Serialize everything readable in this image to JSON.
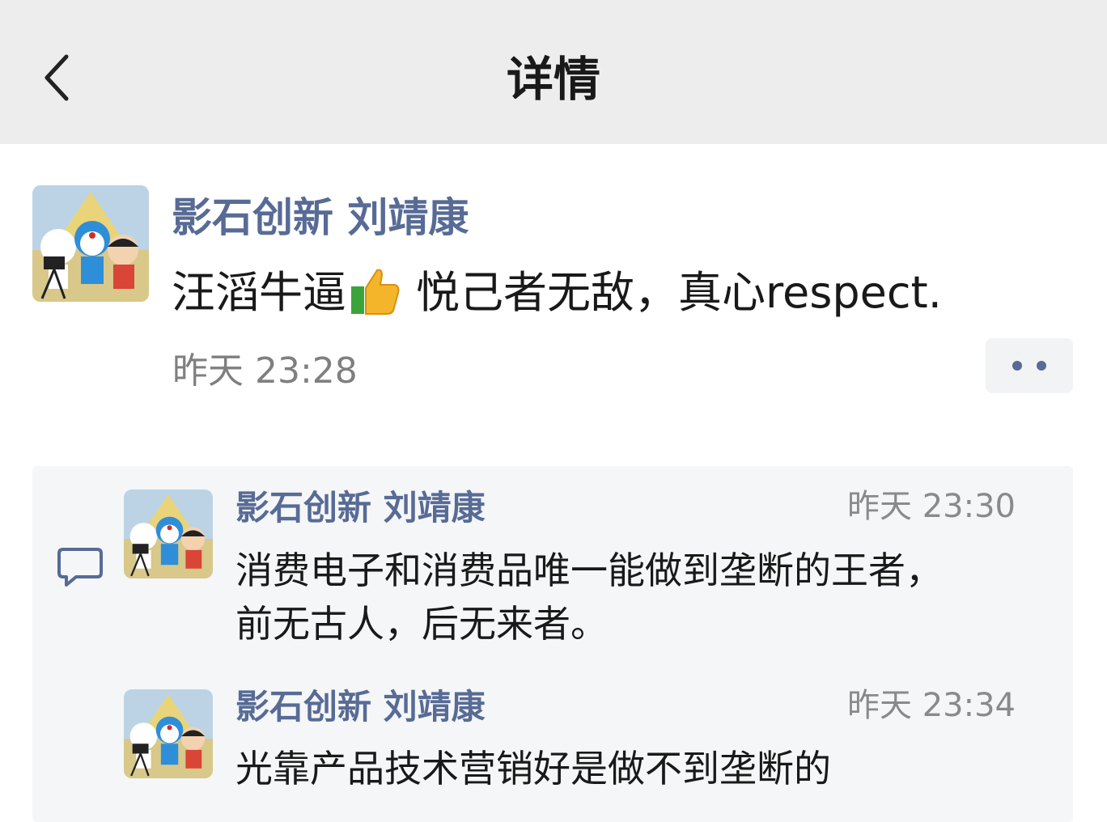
{
  "header": {
    "title": "详情"
  },
  "post": {
    "author": "影石创新 刘靖康",
    "text_before_emoji": "汪滔牛逼",
    "emoji": "thumbs-up-emoji",
    "text_after_emoji": "悦己者无敌，真心respect.",
    "time": "昨天 23:28"
  },
  "comments": [
    {
      "author": "影石创新 刘靖康",
      "time": "昨天 23:30",
      "line1": "消费电子和消费品唯一能做到垄断的王者，",
      "line2": "前无古人，后无来者。"
    },
    {
      "author": "影石创新 刘靖康",
      "time": "昨天 23:34",
      "line1": "光靠产品技术营销好是做不到垄断的"
    }
  ],
  "colors": {
    "nickname": "#576b95",
    "header_bg": "#ededed",
    "panel_bg": "#f5f6f7"
  }
}
